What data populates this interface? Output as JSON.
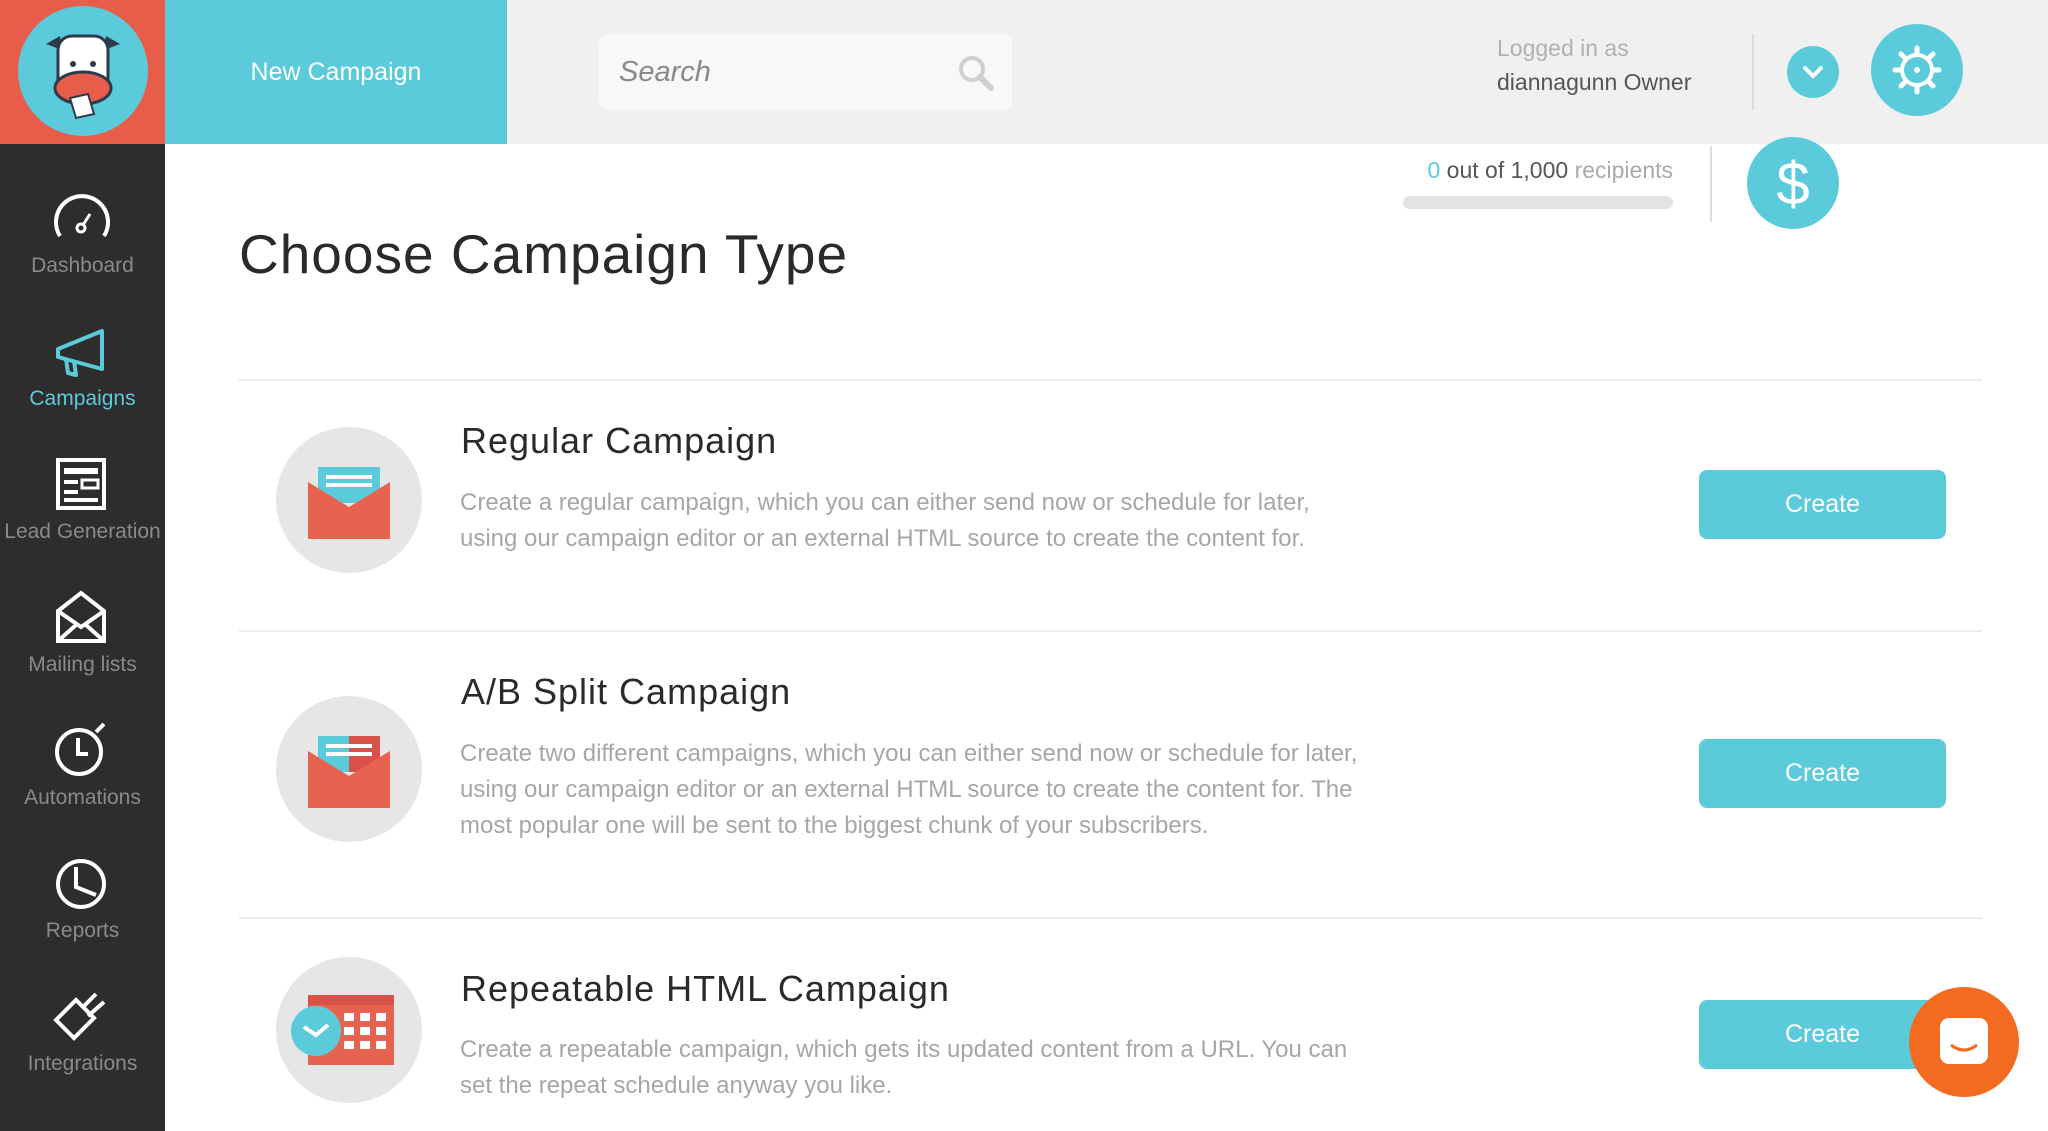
{
  "header": {
    "new_campaign": "New Campaign",
    "search_placeholder": "Search",
    "logged_in_label": "Logged in as",
    "user": "diannagunn Owner"
  },
  "usage": {
    "used": "0",
    "of_text": "out of 1,000",
    "unit": "recipients",
    "progress_percent": 0
  },
  "sidebar": {
    "items": [
      {
        "label": "Dashboard",
        "icon": "gauge-icon"
      },
      {
        "label": "Campaigns",
        "icon": "megaphone-icon",
        "active": true
      },
      {
        "label": "Lead Generation",
        "icon": "form-icon"
      },
      {
        "label": "Mailing lists",
        "icon": "envelope-icon"
      },
      {
        "label": "Automations",
        "icon": "stopwatch-icon"
      },
      {
        "label": "Reports",
        "icon": "pie-clock-icon"
      },
      {
        "label": "Integrations",
        "icon": "plug-icon"
      }
    ]
  },
  "main": {
    "title": "Choose Campaign Type",
    "campaigns": [
      {
        "title": "Regular Campaign",
        "desc": "Create a regular campaign, which you can either send now or schedule for later, using our campaign editor or an external HTML source to create the content for.",
        "button": "Create"
      },
      {
        "title": "A/B Split Campaign",
        "desc": "Create two different campaigns, which you can either send now or schedule for later, using our campaign editor or an external HTML source to create the content for. The most popular one will be sent to the biggest chunk of your subscribers.",
        "button": "Create"
      },
      {
        "title": "Repeatable HTML Campaign",
        "desc": "Create a repeatable campaign, which gets its updated content from a URL. You can set the repeat schedule anyway you like.",
        "button": "Create"
      }
    ]
  },
  "colors": {
    "accent": "#5bcbdc",
    "brand_red": "#e85c4a",
    "sidebar": "#2d2d2d",
    "chat": "#f26b21"
  }
}
